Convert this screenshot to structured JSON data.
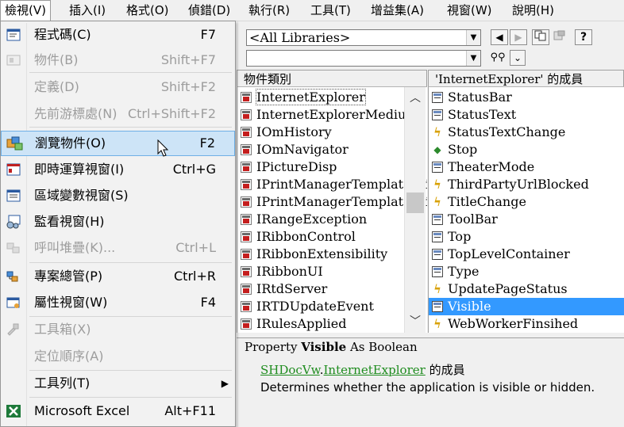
{
  "menubar": {
    "items": [
      {
        "label": "檢視(V)"
      },
      {
        "label": "插入(I)"
      },
      {
        "label": "格式(O)"
      },
      {
        "label": "偵錯(D)"
      },
      {
        "label": "執行(R)"
      },
      {
        "label": "工具(T)"
      },
      {
        "label": "增益集(A)"
      },
      {
        "label": "視窗(W)"
      },
      {
        "label": "說明(H)"
      }
    ]
  },
  "view_menu": {
    "items": [
      {
        "label": "程式碼(C)",
        "shortcut": "F7",
        "icon": "code-window-icon",
        "enabled": true
      },
      {
        "label": "物件(B)",
        "shortcut": "Shift+F7",
        "icon": "object-icon",
        "enabled": false
      },
      {
        "label": "定義(D)",
        "shortcut": "Shift+F2",
        "icon": "",
        "enabled": false
      },
      {
        "label": "先前游標處(N)",
        "shortcut": "Ctrl+Shift+F2",
        "icon": "",
        "enabled": false
      },
      {
        "label": "瀏覽物件(O)",
        "shortcut": "F2",
        "icon": "object-browser-icon",
        "enabled": true,
        "highlighted": true
      },
      {
        "label": "即時運算視窗(I)",
        "shortcut": "Ctrl+G",
        "icon": "immediate-window-icon",
        "enabled": true
      },
      {
        "label": "區域變數視窗(S)",
        "shortcut": "",
        "icon": "locals-window-icon",
        "enabled": true
      },
      {
        "label": "監看視窗(H)",
        "shortcut": "",
        "icon": "watch-window-icon",
        "enabled": true
      },
      {
        "label": "呼叫堆疊(K)...",
        "shortcut": "Ctrl+L",
        "icon": "call-stack-icon",
        "enabled": false
      },
      {
        "label": "專案總管(P)",
        "shortcut": "Ctrl+R",
        "icon": "project-explorer-icon",
        "enabled": true
      },
      {
        "label": "屬性視窗(W)",
        "shortcut": "F4",
        "icon": "properties-window-icon",
        "enabled": true
      },
      {
        "label": "工具箱(X)",
        "shortcut": "",
        "icon": "toolbox-icon",
        "enabled": false
      },
      {
        "label": "定位順序(A)",
        "shortcut": "",
        "icon": "",
        "enabled": false
      },
      {
        "label": "工具列(T)",
        "shortcut": "",
        "icon": "",
        "enabled": true,
        "submenu": true
      },
      {
        "label": "Microsoft Excel",
        "shortcut": "Alt+F11",
        "icon": "excel-icon",
        "enabled": true
      }
    ]
  },
  "browser": {
    "library_combo": "<All Libraries>",
    "search_combo": "",
    "classes_header": "物件類別",
    "members_header": "'InternetExplorer' 的成員",
    "classes": [
      "InternetExplorer",
      "InternetExplorerMedium",
      "IOmHistory",
      "IOmNavigator",
      "IPictureDisp",
      "IPrintManagerTemplatePri",
      "IPrintManagerTemplatePri",
      "IRangeException",
      "IRibbonControl",
      "IRibbonExtensibility",
      "IRibbonUI",
      "IRtdServer",
      "IRTDUpdateEvent",
      "IRulesApplied"
    ],
    "members": [
      {
        "name": "StatusBar",
        "kind": "property"
      },
      {
        "name": "StatusText",
        "kind": "property"
      },
      {
        "name": "StatusTextChange",
        "kind": "event"
      },
      {
        "name": "Stop",
        "kind": "method"
      },
      {
        "name": "TheaterMode",
        "kind": "property"
      },
      {
        "name": "ThirdPartyUrlBlocked",
        "kind": "event"
      },
      {
        "name": "TitleChange",
        "kind": "event"
      },
      {
        "name": "ToolBar",
        "kind": "property"
      },
      {
        "name": "Top",
        "kind": "property"
      },
      {
        "name": "TopLevelContainer",
        "kind": "property"
      },
      {
        "name": "Type",
        "kind": "property"
      },
      {
        "name": "UpdatePageStatus",
        "kind": "event"
      },
      {
        "name": "Visible",
        "kind": "property",
        "selected": true
      },
      {
        "name": "WebWorkerFinsihed",
        "kind": "event"
      }
    ],
    "details": {
      "prefix": "Property",
      "member_name": "Visible",
      "type_text": "As Boolean",
      "library_link": "SHDocVw",
      "dot": ".",
      "class_link": "InternetExplorer",
      "member_of_suffix": "的成員",
      "description": "Determines whether the application is visible or hidden."
    }
  },
  "colors": {
    "selection": "#3399ff",
    "link": "#1e8c1e",
    "menu_highlight": "#cde4f7"
  }
}
